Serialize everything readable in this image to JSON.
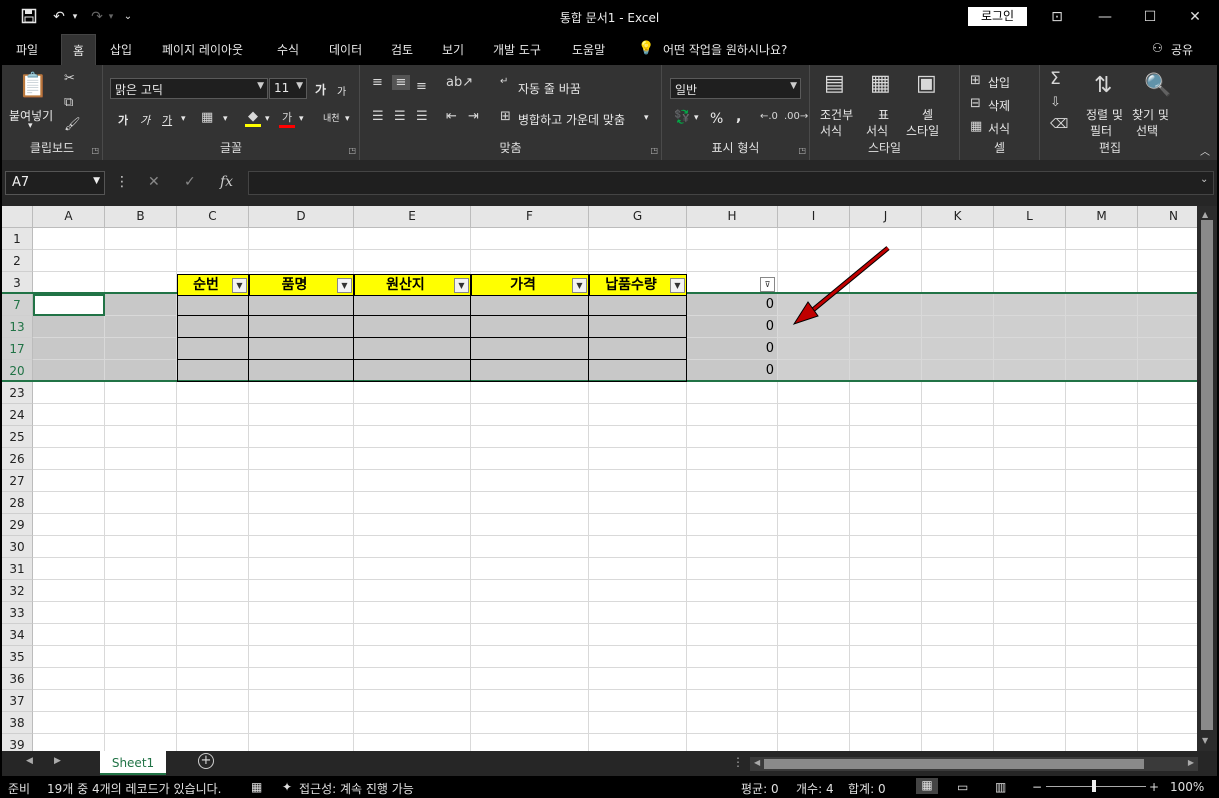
{
  "window": {
    "title": "통합 문서1  -  Excel",
    "signin": "로그인"
  },
  "tabs": [
    "파일",
    "홈",
    "삽입",
    "페이지 레이아웃",
    "수식",
    "데이터",
    "검토",
    "보기",
    "개발 도구",
    "도움말"
  ],
  "tellme": "어떤 작업을 원하시나요?",
  "share": "공유",
  "ribbon": {
    "clipboard": {
      "label": "클립보드",
      "paste": "붙여넣기"
    },
    "font": {
      "label": "글꼴",
      "name": "맑은 고딕",
      "size": "11",
      "bold": "가",
      "italic": "가",
      "underline": "가",
      "grow": "가",
      "shrink": "가",
      "phonetic": "내천"
    },
    "alignment": {
      "label": "맞춤",
      "wrap": "자동 줄 바꿈",
      "merge": "병합하고 가운데 맞춤"
    },
    "number": {
      "label": "표시 형식",
      "format": "일반",
      "percent": "%",
      "comma": ","
    },
    "styles": {
      "label": "스타일",
      "cond1": "조건부",
      "cond2": "서식",
      "table1": "표",
      "table2": "서식",
      "cell1": "셀",
      "cell2": "스타일"
    },
    "cells": {
      "label": "셀",
      "insert": "삽입",
      "delete": "삭제",
      "format": "서식"
    },
    "editing": {
      "label": "편집",
      "sort1": "정렬 및",
      "sort2": "필터",
      "find1": "찾기 및",
      "find2": "선택"
    }
  },
  "formula": {
    "namebox": "A7",
    "fx": "fx",
    "value": ""
  },
  "grid": {
    "columns": [
      "A",
      "B",
      "C",
      "D",
      "E",
      "F",
      "G",
      "H",
      "I",
      "J",
      "K",
      "L",
      "M",
      "N"
    ],
    "rows": [
      "1",
      "2",
      "3",
      "7",
      "13",
      "17",
      "20",
      "23",
      "24",
      "25",
      "26",
      "27",
      "28",
      "29",
      "30",
      "31",
      "32",
      "33",
      "34",
      "35",
      "36",
      "37",
      "38",
      "39"
    ],
    "headers": [
      "순번",
      "품명",
      "원산지",
      "가격",
      "납품수량"
    ],
    "h_values": [
      "0",
      "0",
      "0",
      "0"
    ]
  },
  "sheet": {
    "name": "Sheet1"
  },
  "status": {
    "ready": "준비",
    "records": "19개 중 4개의 레코드가 있습니다.",
    "accessibility": "접근성: 계속 진행 가능",
    "average": "평균: 0",
    "count": "개수: 4",
    "sum": "합계: 0",
    "zoom": "100%"
  },
  "colors": {
    "accent": "#217346",
    "header_fill": "#ffff00",
    "arrow": "#c00000"
  }
}
